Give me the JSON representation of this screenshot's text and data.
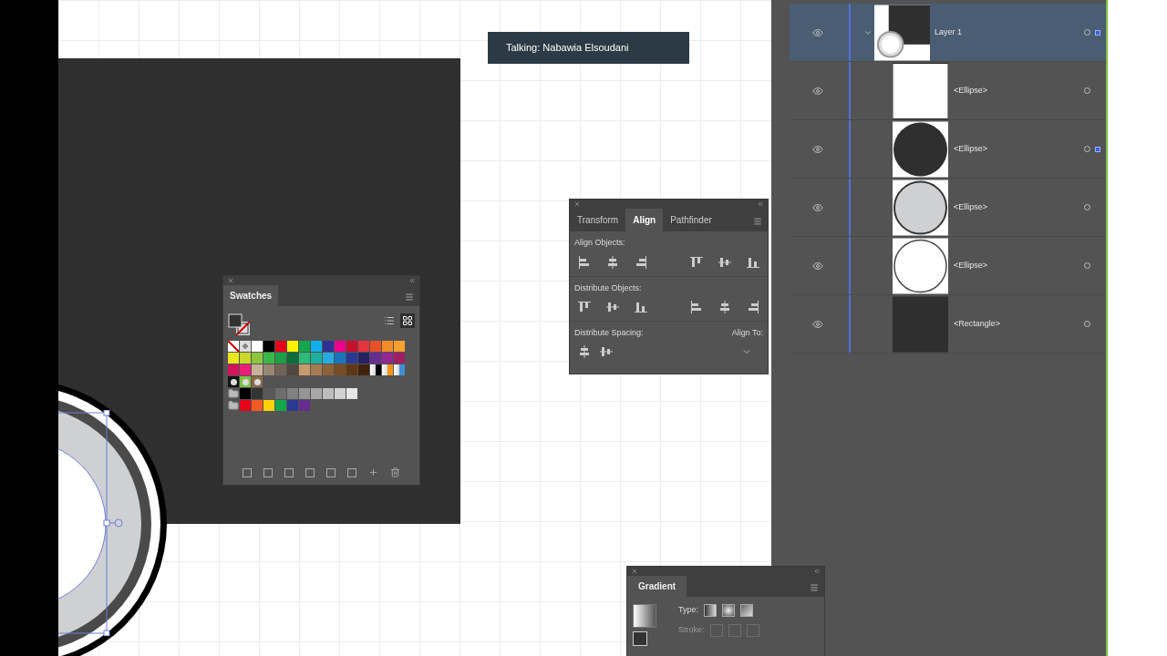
{
  "speaker_banner": "Talking: Nabawia Elsoudani",
  "swatches_panel": {
    "title": "Swatches",
    "grid_view": true,
    "rows": [
      [
        {
          "kind": "none"
        },
        {
          "kind": "registration"
        },
        {
          "kind": "color",
          "color": "#ffffff"
        },
        {
          "kind": "color",
          "color": "#000000"
        },
        {
          "kind": "color",
          "color": "#e3051b"
        },
        {
          "kind": "color",
          "color": "#fff200"
        },
        {
          "kind": "color",
          "color": "#13a64a"
        },
        {
          "kind": "color",
          "color": "#12b0e8"
        },
        {
          "kind": "color",
          "color": "#2e3192"
        },
        {
          "kind": "color",
          "color": "#ec008c"
        },
        {
          "kind": "color",
          "color": "#c8102e"
        },
        {
          "kind": "color",
          "color": "#e4343c"
        },
        {
          "kind": "color",
          "color": "#e8502a"
        },
        {
          "kind": "color",
          "color": "#f28c28"
        },
        {
          "kind": "color",
          "color": "#f5a030"
        }
      ],
      [
        {
          "kind": "color",
          "color": "#e8e820"
        },
        {
          "kind": "color",
          "color": "#c9d82a"
        },
        {
          "kind": "color",
          "color": "#8cc63f"
        },
        {
          "kind": "color",
          "color": "#3cb84a"
        },
        {
          "kind": "color",
          "color": "#1e9e48"
        },
        {
          "kind": "color",
          "color": "#0b6e3a"
        },
        {
          "kind": "color",
          "color": "#2dbb7a"
        },
        {
          "kind": "color",
          "color": "#1eb0a0"
        },
        {
          "kind": "color",
          "color": "#29abe2"
        },
        {
          "kind": "color",
          "color": "#1b75bb"
        },
        {
          "kind": "color",
          "color": "#2b3990"
        },
        {
          "kind": "color",
          "color": "#262262"
        },
        {
          "kind": "color",
          "color": "#662d91"
        },
        {
          "kind": "color",
          "color": "#92278f"
        },
        {
          "kind": "color",
          "color": "#9e1f63"
        }
      ],
      [
        {
          "kind": "color",
          "color": "#d4145a"
        },
        {
          "kind": "color",
          "color": "#ed1e79"
        },
        {
          "kind": "color",
          "color": "#c7b299"
        },
        {
          "kind": "color",
          "color": "#998675"
        },
        {
          "kind": "color",
          "color": "#736357"
        },
        {
          "kind": "color",
          "color": "#534741"
        },
        {
          "kind": "color",
          "color": "#c69c6d"
        },
        {
          "kind": "color",
          "color": "#a67c52"
        },
        {
          "kind": "color",
          "color": "#8c6239"
        },
        {
          "kind": "color",
          "color": "#754c24"
        },
        {
          "kind": "color",
          "color": "#603813"
        },
        {
          "kind": "color",
          "color": "#42210b"
        },
        {
          "kind": "gradient",
          "color": "#000000"
        },
        {
          "kind": "gradient",
          "color": "#f7941d"
        },
        {
          "kind": "gradient",
          "color": "#3f8fd2"
        }
      ],
      [
        {
          "kind": "pattern",
          "color": "#111111"
        },
        {
          "kind": "pattern",
          "color": "#7cc242"
        },
        {
          "kind": "pattern",
          "color": "#8a6a4a"
        }
      ],
      [
        {
          "kind": "folder"
        },
        {
          "kind": "color",
          "color": "#000000"
        },
        {
          "kind": "color",
          "color": "#333333"
        },
        {
          "kind": "color",
          "color": "#595959"
        },
        {
          "kind": "color",
          "color": "#6d6d6d"
        },
        {
          "kind": "color",
          "color": "#808080"
        },
        {
          "kind": "color",
          "color": "#959595"
        },
        {
          "kind": "color",
          "color": "#a8a8a8"
        },
        {
          "kind": "color",
          "color": "#bdbdbd"
        },
        {
          "kind": "color",
          "color": "#d1d1d1"
        },
        {
          "kind": "color",
          "color": "#e6e6e6"
        }
      ],
      [
        {
          "kind": "folder"
        },
        {
          "kind": "color",
          "color": "#e3051b"
        },
        {
          "kind": "color",
          "color": "#f15a24"
        },
        {
          "kind": "color",
          "color": "#fcd20a"
        },
        {
          "kind": "color",
          "color": "#13a64a"
        },
        {
          "kind": "color",
          "color": "#2b3990"
        },
        {
          "kind": "color",
          "color": "#662d91"
        }
      ]
    ]
  },
  "align_panel": {
    "tabs": [
      {
        "label": "Transform",
        "selected": false
      },
      {
        "label": "Align",
        "selected": true
      },
      {
        "label": "Pathfinder",
        "selected": false
      }
    ],
    "align_objects_label": "Align Objects:",
    "distribute_objects_label": "Distribute Objects:",
    "distribute_spacing_label": "Distribute Spacing:",
    "align_to_label": "Align To:"
  },
  "gradient_panel": {
    "title": "Gradient",
    "type_label": "Type:",
    "stroke_label": "Stroke:",
    "stroke_disabled": true
  },
  "layers": [
    {
      "name": "Layer 1",
      "kind": "layer",
      "selected": true,
      "expanded": true,
      "has_selection": true,
      "children": [
        {
          "name": "<Ellipse>",
          "kind": "blank",
          "selected": false,
          "has_selection": false
        },
        {
          "name": "<Ellipse>",
          "kind": "dark-circle",
          "selected": false,
          "has_selection": true
        },
        {
          "name": "<Ellipse>",
          "kind": "gray-circle",
          "selected": false,
          "has_selection": false
        },
        {
          "name": "<Ellipse>",
          "kind": "white-circle",
          "selected": false,
          "has_selection": false
        },
        {
          "name": "<Rectangle>",
          "kind": "dark-rect",
          "selected": false,
          "has_selection": false
        }
      ]
    }
  ]
}
